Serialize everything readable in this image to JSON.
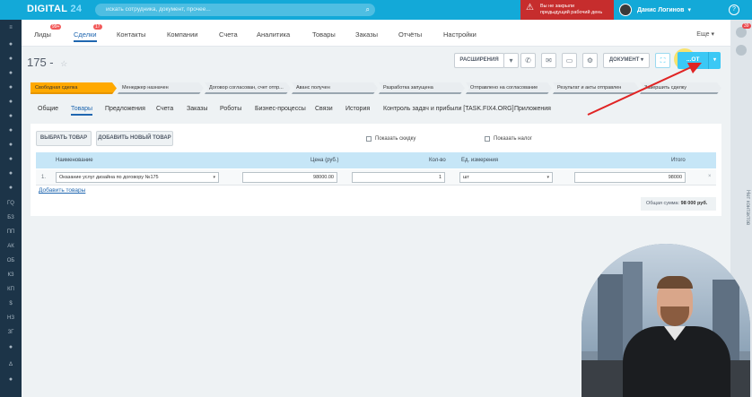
{
  "topbar": {
    "logo_text": "DIGITAL",
    "logo_number": "24",
    "search_placeholder": "искать сотрудника, документ, прочее...",
    "alert_line1": "Вы не закрыли",
    "alert_line2": "предыдущий рабочий день",
    "user_name": "Данис Логинов",
    "help_label": "?"
  },
  "left_sidebar": {
    "items": [
      "≡",
      "●",
      "●",
      "●",
      "●",
      "●",
      "●",
      "●",
      "●",
      "●",
      "●",
      "●",
      "ГQ",
      "БЗ",
      "ПП",
      "АК",
      "ОБ",
      "КЗ",
      "КП",
      "$",
      "НЗ",
      "ЗГ",
      "●",
      "Δ",
      "●"
    ]
  },
  "right_sidebar": {
    "badge": "39",
    "vertical_text": "Нет контактов"
  },
  "nav": {
    "items": [
      {
        "label": "Лиды",
        "count": "99+"
      },
      {
        "label": "Сделки",
        "count": "17"
      },
      {
        "label": "Контакты"
      },
      {
        "label": "Компании"
      },
      {
        "label": "Счета"
      },
      {
        "label": "Аналитика"
      },
      {
        "label": "Товары"
      },
      {
        "label": "Заказы"
      },
      {
        "label": "Отчёты"
      },
      {
        "label": "Настройки"
      }
    ],
    "more_label": "Еще ▾"
  },
  "deal": {
    "title": "175 -",
    "star": "☆"
  },
  "toolbar": {
    "extensions_label": "РАСШИРЕНИЯ",
    "document_label": "ДОКУМЕНТ ▾",
    "primary_label": "...ОТ"
  },
  "stages": [
    "Свободная сделка",
    "Менеджер назначен",
    "Договор согласован, счет отпр...",
    "Аванс получен",
    "Разработка запущена",
    "Отправлено на согласование",
    "Результат и акты отправлен",
    "Завершить сделку"
  ],
  "tabs": [
    "Общие",
    "Товары",
    "Предложения",
    "Счета",
    "Заказы",
    "Роботы",
    "Бизнес-процессы",
    "Связи",
    "История",
    "Контроль задач и прибыли [TASK.FIX4.ORG]",
    "Приложения"
  ],
  "products": {
    "select_button": "ВЫБРАТЬ ТОВАР",
    "add_new_button": "ДОБАВИТЬ НОВЫЙ ТОВАР",
    "show_discount": "Показать скидку",
    "show_tax": "Показать налог",
    "columns": {
      "name": "Наименование",
      "price": "Цена (руб.)",
      "qty": "Кол-во",
      "unit": "Ед. измерения",
      "total": "Итого"
    },
    "rows": [
      {
        "index": "1.",
        "name": "Оказание услуг дизайна по договору №175",
        "price": "98000.00",
        "qty": "1",
        "unit": "шт",
        "total": "98000"
      }
    ],
    "add_link": "Добавить товары",
    "total_label": "Общая сумма:",
    "total_value": "98 000 руб."
  },
  "colors": {
    "topbar": "#13a9d8",
    "stage_active": "#ffa900",
    "primary_button": "#3bc8f5",
    "arrow": "#e02424"
  }
}
